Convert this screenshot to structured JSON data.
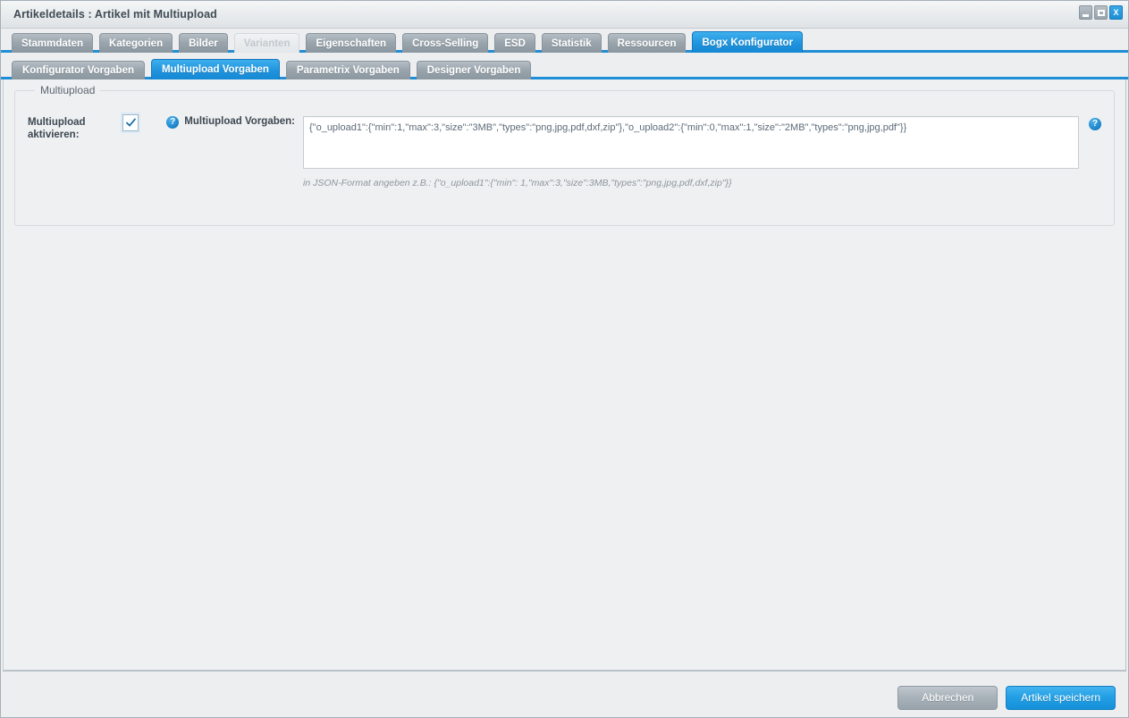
{
  "window": {
    "title": "Artikeldetails : Artikel mit Multiupload",
    "buttons": {
      "minimize": "minimize-icon",
      "maximize": "maximize-icon",
      "close": "X"
    }
  },
  "tabs": [
    {
      "label": "Stammdaten",
      "state": "normal"
    },
    {
      "label": "Kategorien",
      "state": "normal"
    },
    {
      "label": "Bilder",
      "state": "normal"
    },
    {
      "label": "Varianten",
      "state": "disabled"
    },
    {
      "label": "Eigenschaften",
      "state": "normal"
    },
    {
      "label": "Cross-Selling",
      "state": "normal"
    },
    {
      "label": "ESD",
      "state": "normal"
    },
    {
      "label": "Statistik",
      "state": "normal"
    },
    {
      "label": "Ressourcen",
      "state": "normal"
    },
    {
      "label": "Bogx Konfigurator",
      "state": "active"
    }
  ],
  "subtabs": [
    {
      "label": "Konfigurator Vorgaben",
      "state": "normal"
    },
    {
      "label": "Multiupload Vorgaben",
      "state": "active"
    },
    {
      "label": "Parametrix Vorgaben",
      "state": "normal"
    },
    {
      "label": "Designer Vorgaben",
      "state": "normal"
    }
  ],
  "fieldset": {
    "legend": "Multiupload",
    "activate_label": "Multiupload aktivieren:",
    "activate_checked": true,
    "checkmark": "✓",
    "help_glyph": "?",
    "vorgaben_label": "Multiupload Vorgaben:",
    "textarea_value": "{\"o_upload1\":{\"min\":1,\"max\":3,\"size\":\"3MB\",\"types\":\"png,jpg,pdf,dxf,zip\"},\"o_upload2\":{\"min\":0,\"max\":1,\"size\":\"2MB\",\"types\":\"png,jpg,pdf\"}}",
    "textarea_placeholder": "",
    "hint": "in JSON-Format angeben z.B.: {\"o_upload1\":{\"min\": 1,\"max\":3,\"size\":3MB,\"types\":\"png,jpg,pdf,dxf,zip\"}}"
  },
  "footer": {
    "cancel_label": "Abbrechen",
    "save_label": "Artikel speichern"
  },
  "colors": {
    "accent": "#1f8ed6",
    "tab_inactive": "#9aa5ad",
    "panel_bg": "#eff0f2",
    "chrome_bg": "#eceef0"
  }
}
